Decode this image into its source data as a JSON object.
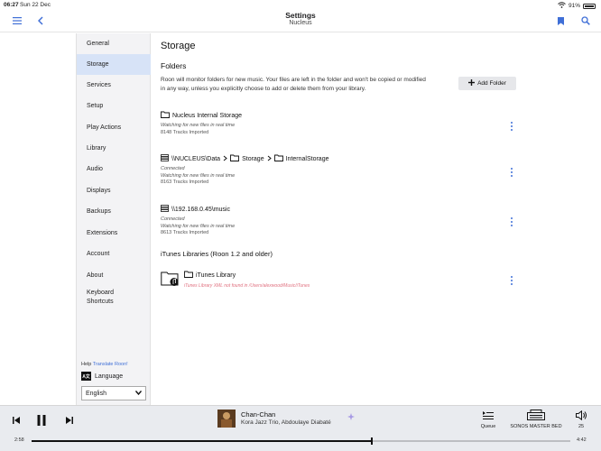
{
  "status_bar": {
    "time": "06:27",
    "date": "Sun 22 Dec",
    "battery": "91%"
  },
  "header": {
    "title": "Settings",
    "subtitle": "Nucleus"
  },
  "nav": {
    "items": [
      {
        "label": "General"
      },
      {
        "label": "Storage",
        "active": true
      },
      {
        "label": "Services"
      },
      {
        "label": "Setup"
      },
      {
        "label": "Play Actions"
      },
      {
        "label": "Library"
      },
      {
        "label": "Audio"
      },
      {
        "label": "Displays"
      },
      {
        "label": "Backups"
      },
      {
        "label": "Extensions"
      },
      {
        "label": "Account"
      },
      {
        "label": "About"
      }
    ],
    "keyboard_line1": "Keyboard",
    "keyboard_line2": "Shortcuts",
    "help_label": "Help",
    "help_link": "Translate Roon!",
    "language_label": "Language",
    "language_value": "English"
  },
  "main": {
    "title": "Storage",
    "folders_heading": "Folders",
    "description": "Roon will monitor folders for new music. Your files are left in the folder and won't be copied or modified in any way, unless you explicitly choose to add or delete them from your library.",
    "add_folder_label": "Add Folder",
    "folders": [
      {
        "name": "Nucleus Internal Storage",
        "connected": "",
        "status": "Watching for new files in real time",
        "count": "8148 Tracks Imported"
      },
      {
        "seg1": "\\\\NUCLEUS\\Data",
        "seg2": "Storage",
        "seg3": "InternalStorage",
        "connected": "Connected",
        "status": "Watching for new files in real time",
        "count": "8163 Tracks Imported"
      },
      {
        "name": "\\\\192.168.0.45\\music",
        "connected": "Connected",
        "status": "Watching for new files in real time",
        "count": "8613 Tracks Imported"
      }
    ],
    "itunes_heading": "iTunes Libraries (Roon 1.2 and older)",
    "itunes": {
      "name": "iTunes Library",
      "error": "iTunes Library XML not found in /Users/alexwood/Music/iTunes"
    }
  },
  "player": {
    "track_title": "Chan-Chan",
    "track_artist": "Kora Jazz Trio, Abdoulaye Diabaté",
    "queue_label": "Queue",
    "zone_label": "SONOS MASTER BED",
    "volume": "25",
    "elapsed": "2:58",
    "duration": "4:42",
    "progress": 0.63
  }
}
